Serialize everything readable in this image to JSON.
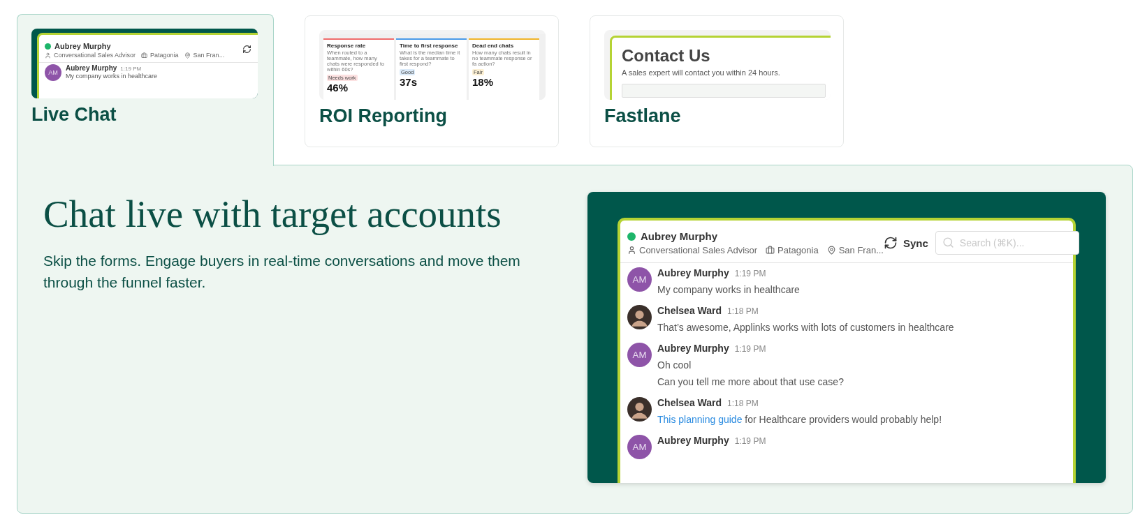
{
  "tabs": [
    {
      "label": "Live Chat",
      "selected": true,
      "kind": "chat",
      "preview": {
        "name": "Aubrey Murphy",
        "online": true,
        "meta": [
          {
            "kind": "person",
            "text": "Conversational Sales Advisor"
          },
          {
            "kind": "company",
            "text": "Patagonia"
          },
          {
            "kind": "location",
            "text": "San Fran..."
          }
        ],
        "message": {
          "initials": "AM",
          "author": "Aubrey Murphy",
          "time": "1:19 PM",
          "text": "My company works in healthcare"
        }
      }
    },
    {
      "label": "ROI Reporting",
      "selected": false,
      "kind": "report",
      "preview": {
        "metrics": [
          {
            "title": "Response rate",
            "description": "When routed to a teammate, how many chats were responded to within 60s?",
            "badge": "Needs work",
            "value": "46%",
            "color": "#ef6b6b"
          },
          {
            "title": "Time to first response",
            "description": "What is the median time it takes for a teammate to first respond?",
            "badge": "Good",
            "value": "37s",
            "color": "#4a9ae8"
          },
          {
            "title": "Dead end chats",
            "description": "How many chats result in no teammate response or fa action?",
            "badge": "Fair",
            "value": "18%",
            "color": "#f0b429"
          }
        ]
      }
    },
    {
      "label": "Fastlane",
      "selected": false,
      "kind": "form",
      "preview": {
        "title": "Contact Us",
        "subtitle": "A sales expert will contact you within 24 hours."
      }
    }
  ],
  "feature": {
    "heading": "Chat live with target accounts",
    "body": "Skip the forms. Engage buyers in real-time conversations and move them through the funnel faster.",
    "chat": {
      "contact": {
        "name": "Aubrey Murphy",
        "online": true,
        "meta": [
          {
            "kind": "person",
            "text": "Conversational Sales Advisor"
          },
          {
            "kind": "company",
            "text": "Patagonia"
          },
          {
            "kind": "location",
            "text": "San Fran..."
          }
        ]
      },
      "sync_label": "Sync",
      "search": {
        "placeholder": "Search (⌘K)..."
      },
      "messages": [
        {
          "author": "Aubrey Murphy",
          "time": "1:19 PM",
          "avatar": {
            "kind": "initials",
            "initials": "AM"
          },
          "lines": [
            {
              "text": "My company works in healthcare"
            }
          ]
        },
        {
          "author": "Chelsea Ward",
          "time": "1:18 PM",
          "avatar": {
            "kind": "photo"
          },
          "lines": [
            {
              "text": "That’s awesome, Applinks works with lots of customers in healthcare"
            }
          ]
        },
        {
          "author": "Aubrey Murphy",
          "time": "1:19 PM",
          "avatar": {
            "kind": "initials",
            "initials": "AM"
          },
          "lines": [
            {
              "text": "Oh cool"
            },
            {
              "text": "Can you tell me more about that use case?"
            }
          ]
        },
        {
          "author": "Chelsea Ward",
          "time": "1:18 PM",
          "avatar": {
            "kind": "photo"
          },
          "lines": [
            {
              "link": "This planning guide",
              "text": "for Healthcare providers would probably help!"
            }
          ]
        },
        {
          "author": "Aubrey Murphy",
          "time": "1:19 PM",
          "avatar": {
            "kind": "initials",
            "initials": "AM"
          }
        }
      ]
    }
  }
}
